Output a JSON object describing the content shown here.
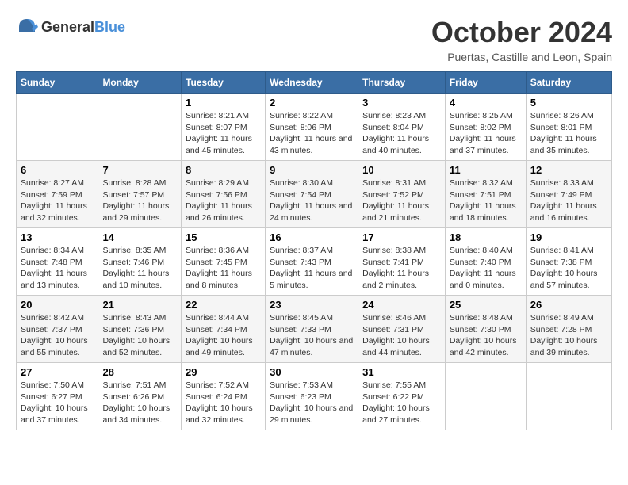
{
  "logo": {
    "text_general": "General",
    "text_blue": "Blue"
  },
  "title": "October 2024",
  "location": "Puertas, Castille and Leon, Spain",
  "headers": [
    "Sunday",
    "Monday",
    "Tuesday",
    "Wednesday",
    "Thursday",
    "Friday",
    "Saturday"
  ],
  "weeks": [
    [
      {
        "day": "",
        "info": ""
      },
      {
        "day": "",
        "info": ""
      },
      {
        "day": "1",
        "info": "Sunrise: 8:21 AM\nSunset: 8:07 PM\nDaylight: 11 hours and 45 minutes."
      },
      {
        "day": "2",
        "info": "Sunrise: 8:22 AM\nSunset: 8:06 PM\nDaylight: 11 hours and 43 minutes."
      },
      {
        "day": "3",
        "info": "Sunrise: 8:23 AM\nSunset: 8:04 PM\nDaylight: 11 hours and 40 minutes."
      },
      {
        "day": "4",
        "info": "Sunrise: 8:25 AM\nSunset: 8:02 PM\nDaylight: 11 hours and 37 minutes."
      },
      {
        "day": "5",
        "info": "Sunrise: 8:26 AM\nSunset: 8:01 PM\nDaylight: 11 hours and 35 minutes."
      }
    ],
    [
      {
        "day": "6",
        "info": "Sunrise: 8:27 AM\nSunset: 7:59 PM\nDaylight: 11 hours and 32 minutes."
      },
      {
        "day": "7",
        "info": "Sunrise: 8:28 AM\nSunset: 7:57 PM\nDaylight: 11 hours and 29 minutes."
      },
      {
        "day": "8",
        "info": "Sunrise: 8:29 AM\nSunset: 7:56 PM\nDaylight: 11 hours and 26 minutes."
      },
      {
        "day": "9",
        "info": "Sunrise: 8:30 AM\nSunset: 7:54 PM\nDaylight: 11 hours and 24 minutes."
      },
      {
        "day": "10",
        "info": "Sunrise: 8:31 AM\nSunset: 7:52 PM\nDaylight: 11 hours and 21 minutes."
      },
      {
        "day": "11",
        "info": "Sunrise: 8:32 AM\nSunset: 7:51 PM\nDaylight: 11 hours and 18 minutes."
      },
      {
        "day": "12",
        "info": "Sunrise: 8:33 AM\nSunset: 7:49 PM\nDaylight: 11 hours and 16 minutes."
      }
    ],
    [
      {
        "day": "13",
        "info": "Sunrise: 8:34 AM\nSunset: 7:48 PM\nDaylight: 11 hours and 13 minutes."
      },
      {
        "day": "14",
        "info": "Sunrise: 8:35 AM\nSunset: 7:46 PM\nDaylight: 11 hours and 10 minutes."
      },
      {
        "day": "15",
        "info": "Sunrise: 8:36 AM\nSunset: 7:45 PM\nDaylight: 11 hours and 8 minutes."
      },
      {
        "day": "16",
        "info": "Sunrise: 8:37 AM\nSunset: 7:43 PM\nDaylight: 11 hours and 5 minutes."
      },
      {
        "day": "17",
        "info": "Sunrise: 8:38 AM\nSunset: 7:41 PM\nDaylight: 11 hours and 2 minutes."
      },
      {
        "day": "18",
        "info": "Sunrise: 8:40 AM\nSunset: 7:40 PM\nDaylight: 11 hours and 0 minutes."
      },
      {
        "day": "19",
        "info": "Sunrise: 8:41 AM\nSunset: 7:38 PM\nDaylight: 10 hours and 57 minutes."
      }
    ],
    [
      {
        "day": "20",
        "info": "Sunrise: 8:42 AM\nSunset: 7:37 PM\nDaylight: 10 hours and 55 minutes."
      },
      {
        "day": "21",
        "info": "Sunrise: 8:43 AM\nSunset: 7:36 PM\nDaylight: 10 hours and 52 minutes."
      },
      {
        "day": "22",
        "info": "Sunrise: 8:44 AM\nSunset: 7:34 PM\nDaylight: 10 hours and 49 minutes."
      },
      {
        "day": "23",
        "info": "Sunrise: 8:45 AM\nSunset: 7:33 PM\nDaylight: 10 hours and 47 minutes."
      },
      {
        "day": "24",
        "info": "Sunrise: 8:46 AM\nSunset: 7:31 PM\nDaylight: 10 hours and 44 minutes."
      },
      {
        "day": "25",
        "info": "Sunrise: 8:48 AM\nSunset: 7:30 PM\nDaylight: 10 hours and 42 minutes."
      },
      {
        "day": "26",
        "info": "Sunrise: 8:49 AM\nSunset: 7:28 PM\nDaylight: 10 hours and 39 minutes."
      }
    ],
    [
      {
        "day": "27",
        "info": "Sunrise: 7:50 AM\nSunset: 6:27 PM\nDaylight: 10 hours and 37 minutes."
      },
      {
        "day": "28",
        "info": "Sunrise: 7:51 AM\nSunset: 6:26 PM\nDaylight: 10 hours and 34 minutes."
      },
      {
        "day": "29",
        "info": "Sunrise: 7:52 AM\nSunset: 6:24 PM\nDaylight: 10 hours and 32 minutes."
      },
      {
        "day": "30",
        "info": "Sunrise: 7:53 AM\nSunset: 6:23 PM\nDaylight: 10 hours and 29 minutes."
      },
      {
        "day": "31",
        "info": "Sunrise: 7:55 AM\nSunset: 6:22 PM\nDaylight: 10 hours and 27 minutes."
      },
      {
        "day": "",
        "info": ""
      },
      {
        "day": "",
        "info": ""
      }
    ]
  ]
}
